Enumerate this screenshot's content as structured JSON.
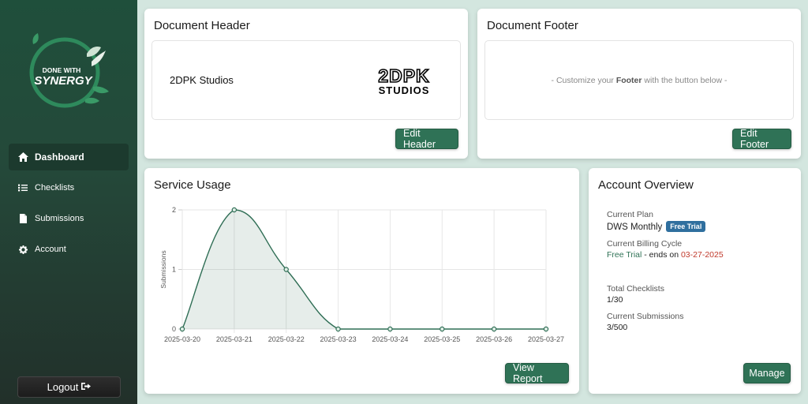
{
  "sidebar": {
    "logo": {
      "line1": "DONE WITH",
      "line2": "SYNERGY"
    },
    "items": [
      {
        "label": "Dashboard",
        "icon": "home-icon",
        "active": true
      },
      {
        "label": "Checklists",
        "icon": "list-check-icon",
        "active": false
      },
      {
        "label": "Submissions",
        "icon": "file-icon",
        "active": false
      },
      {
        "label": "Account",
        "icon": "gear-icon",
        "active": false
      }
    ],
    "logout_label": "Logout"
  },
  "header_card": {
    "title": "Document Header",
    "company_name": "2DPK Studios",
    "logo": {
      "top": "2DPK",
      "bottom": "STUDIOS"
    },
    "button_label": "Edit Header"
  },
  "footer_card": {
    "title": "Document Footer",
    "hint_prefix": "- Customize your ",
    "hint_bold": "Footer",
    "hint_suffix": " with the button below -",
    "button_label": "Edit Footer"
  },
  "usage_card": {
    "title": "Service Usage",
    "button_label": "View Report"
  },
  "account_card": {
    "title": "Account Overview",
    "plan_label": "Current Plan",
    "plan_value": "DWS Monthly",
    "plan_badge": "Free Trial",
    "cycle_label": "Current Billing Cycle",
    "cycle_type": "Free Trial",
    "cycle_middle": " - ends on ",
    "cycle_end": "03-27-2025",
    "checklists_label": "Total Checklists",
    "checklists_value": "1/30",
    "submissions_label": "Current Submissions",
    "submissions_value": "3/500",
    "button_label": "Manage"
  },
  "colors": {
    "accent": "#2f7256",
    "line": "#2f6e55",
    "badge": "#2f6f9e",
    "danger": "#c0392b"
  },
  "chart_data": {
    "type": "area",
    "categories": [
      "2025-03-20",
      "2025-03-21",
      "2025-03-22",
      "2025-03-23",
      "2025-03-24",
      "2025-03-25",
      "2025-03-26",
      "2025-03-27"
    ],
    "values": [
      0,
      2,
      1,
      0,
      0,
      0,
      0,
      0
    ],
    "ylabel": "Submissions",
    "ylim": [
      0,
      2
    ],
    "yticks": [
      0,
      1,
      2
    ],
    "grid": true,
    "legend": "none"
  }
}
